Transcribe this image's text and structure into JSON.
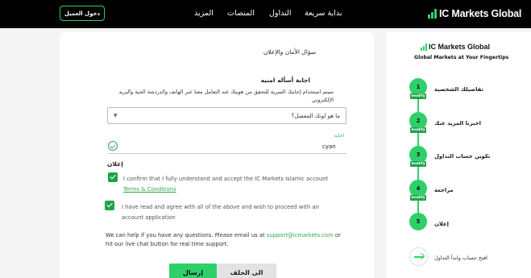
{
  "topnav": {
    "logo_text": "IC Markets Global",
    "items": [
      {
        "label": "بداية سريعة"
      },
      {
        "label": "التداول"
      },
      {
        "label": "المنصات"
      },
      {
        "label": "المزيد"
      }
    ],
    "login_label": "دخول العميل"
  },
  "form": {
    "section_title": "سؤال الأمان والإعلان",
    "question_title": "اجابة أسأله امنيه",
    "question_desc": "سيتم استخدام إجابتك السرية للتحقق من هويتك عند التعامل معنا عبر الهاتف والدردشة الحية والبريد الإلكتروني",
    "select_value": "ما هو لونك المفضل؟",
    "answer_label": "اجابه",
    "answer_value": "cyan",
    "declaration_title": "إعلان",
    "checkbox1_text": "I confirm that I fully understand and accept the IC Markets Islamic account ",
    "checkbox1_link": "Terms & Conditions",
    "checkbox2_text": "I have read and agree with all of the above and wish to proceed with an account application",
    "help_text_1": "We can help if you have any questions. Please email us at ",
    "help_email": "support@icmarkets.com",
    "help_text_2": " or hit our live chat button for real time support.",
    "submit_label": "إرسال",
    "back_label": "الى الخلف"
  },
  "side": {
    "logo_text": "IC Markets Global",
    "subtitle": "Global Markets at Your Fingertips",
    "modify_label": "modify",
    "steps": [
      {
        "num": "1",
        "label": "تفاصيلك الشخصية"
      },
      {
        "num": "2",
        "label": "اخبرنا المزيد عنك"
      },
      {
        "num": "3",
        "label": "تكوين حساب التداول"
      },
      {
        "num": "4",
        "label": "مراجعة"
      },
      {
        "num": "5",
        "label": "إعلان"
      }
    ],
    "open_label": "افتح حساب وابدأ التداول"
  },
  "colors": {
    "accent": "#2fd06a",
    "accent_dark": "#1ea24a",
    "nav_bg": "#000000"
  }
}
